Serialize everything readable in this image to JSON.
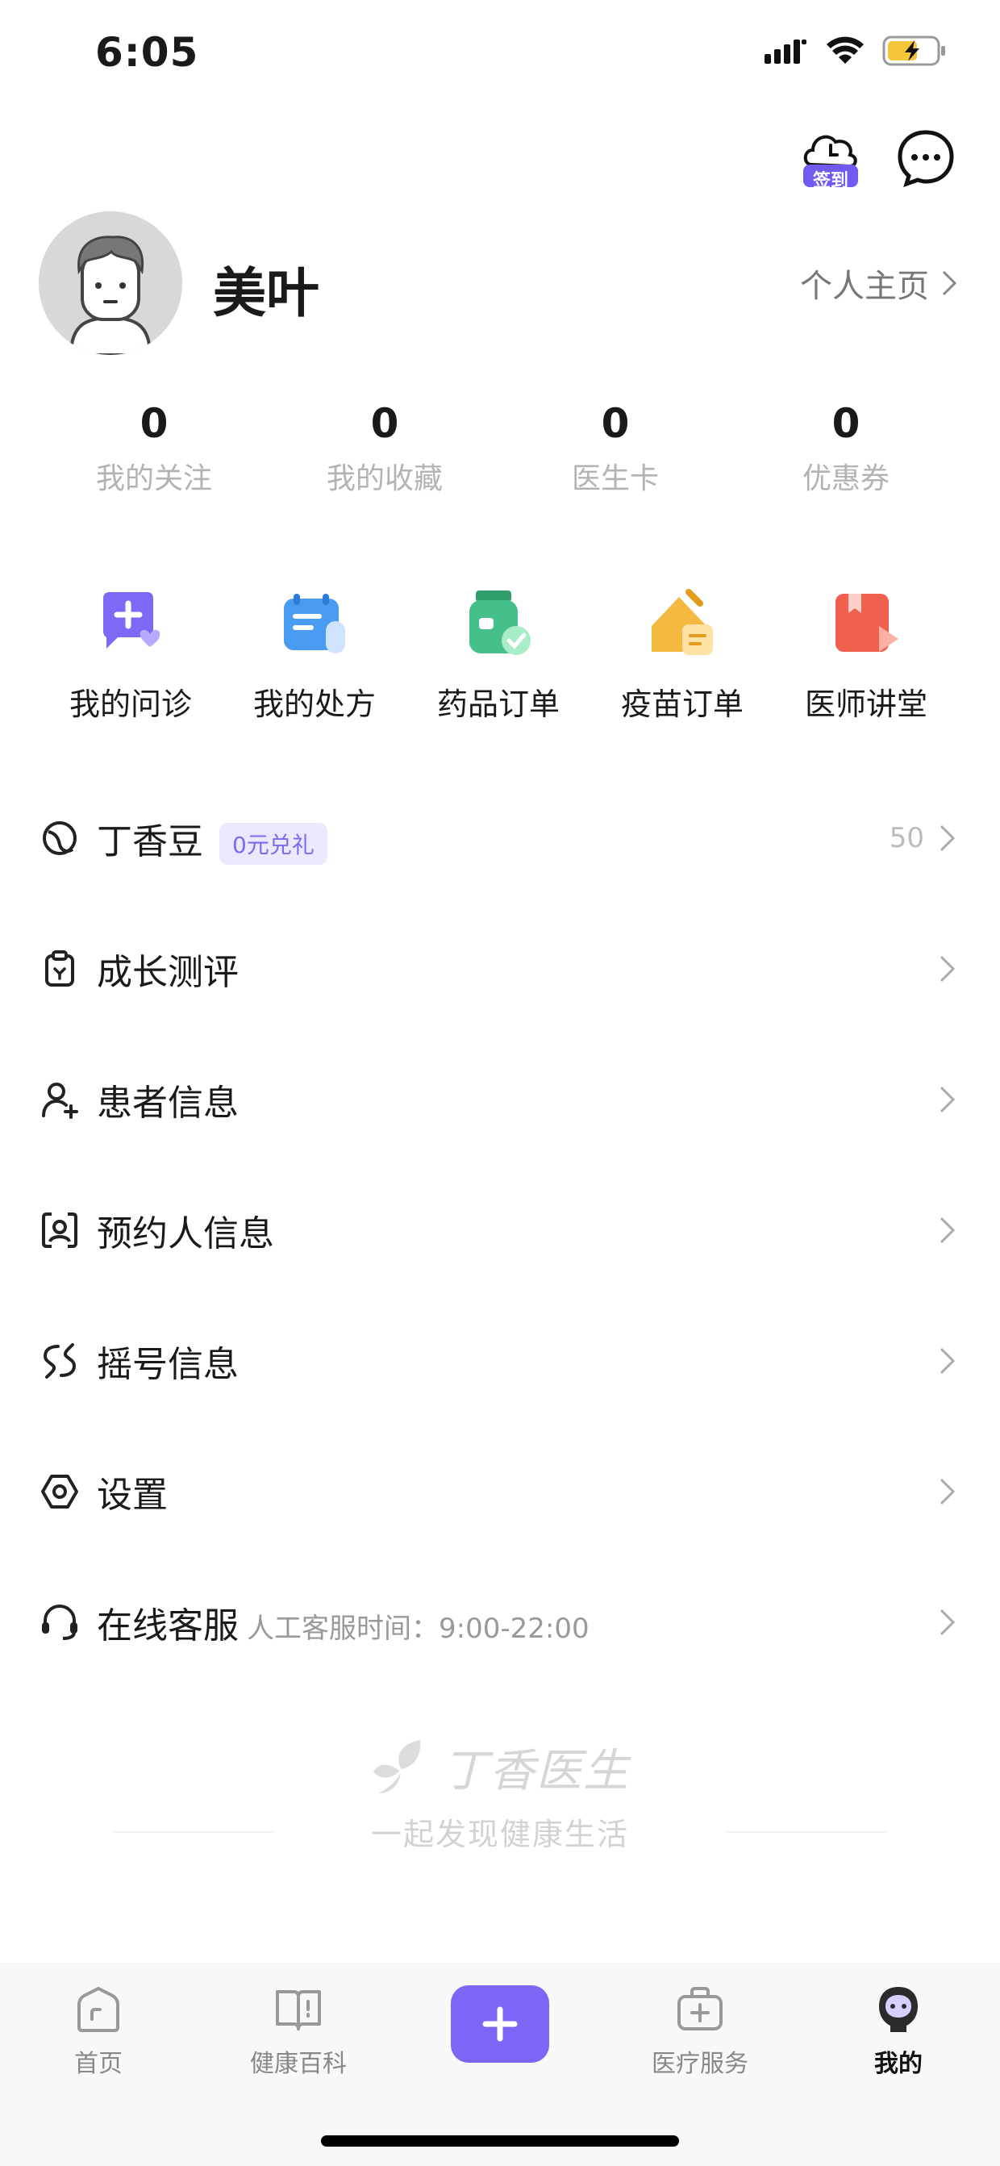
{
  "status_bar": {
    "time": "6:05"
  },
  "header": {
    "checkin_label": "签到"
  },
  "profile": {
    "username": "美叶",
    "homepage_link": "个人主页"
  },
  "stats": [
    {
      "value": "0",
      "label": "我的关注"
    },
    {
      "value": "0",
      "label": "我的收藏"
    },
    {
      "value": "0",
      "label": "医生卡"
    },
    {
      "value": "0",
      "label": "优惠券"
    }
  ],
  "quick_entries": [
    {
      "label": "我的问诊",
      "icon": "consultation-icon"
    },
    {
      "label": "我的处方",
      "icon": "prescription-icon"
    },
    {
      "label": "药品订单",
      "icon": "drug-order-icon"
    },
    {
      "label": "疫苗订单",
      "icon": "vaccine-order-icon"
    },
    {
      "label": "医师讲堂",
      "icon": "lecture-icon"
    }
  ],
  "menu": {
    "dingxiang_beans": {
      "label": "丁香豆",
      "badge": "0元兑礼",
      "value": "50"
    },
    "growth": {
      "label": "成长测评"
    },
    "patient": {
      "label": "患者信息"
    },
    "appointment": {
      "label": "预约人信息"
    },
    "lottery": {
      "label": "摇号信息"
    },
    "settings": {
      "label": "设置"
    },
    "service": {
      "label": "在线客服",
      "hours": "人工客服时间：9:00-22:00"
    }
  },
  "brand": {
    "name": "丁香医生",
    "slogan": "一起发现健康生活"
  },
  "tabbar": [
    {
      "label": "首页"
    },
    {
      "label": "健康百科"
    },
    {
      "label": "医疗服务"
    },
    {
      "label": "我的"
    }
  ],
  "colors": {
    "accent": "#7b66f5",
    "badge_bg": "#ece9ff",
    "muted": "#b3b3b3"
  }
}
